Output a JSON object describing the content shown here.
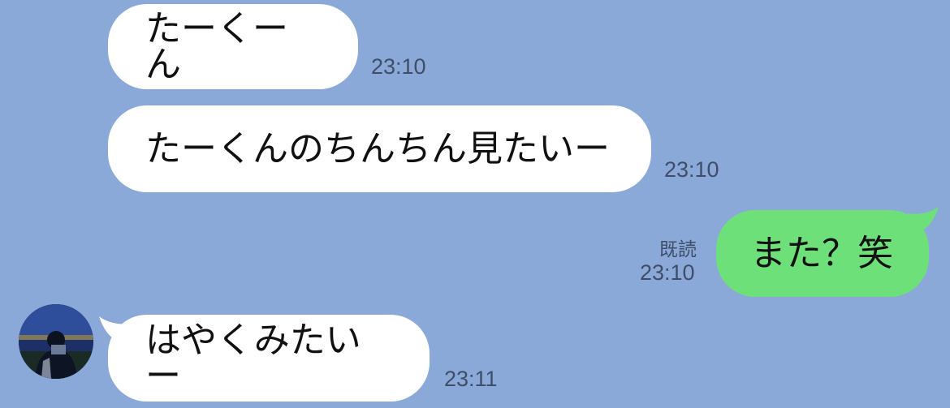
{
  "messages": [
    {
      "id": "m1",
      "direction": "incoming",
      "text": "たーくーん",
      "time": "23:10"
    },
    {
      "id": "m2",
      "direction": "incoming",
      "text": "たーくんのちんちん見たいー",
      "time": "23:10"
    },
    {
      "id": "m3",
      "direction": "outgoing",
      "text": "また？笑",
      "time": "23:10",
      "read_label": "既読"
    },
    {
      "id": "m4",
      "direction": "incoming",
      "text": "はやくみたいー",
      "time": "23:11"
    }
  ],
  "colors": {
    "background": "#8aa9d8",
    "incoming_bubble": "#ffffff",
    "outgoing_bubble": "#6ee07a",
    "meta_text": "#3f4e68"
  },
  "icons": {
    "avatar": "user-photo-avatar"
  }
}
